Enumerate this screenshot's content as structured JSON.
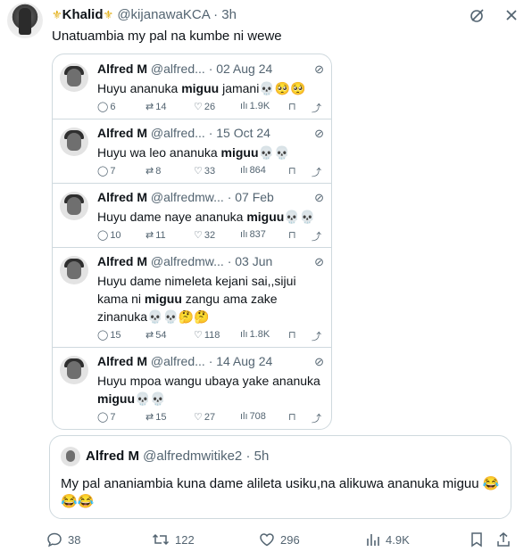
{
  "tweet": {
    "crown_left": "⚜",
    "author_name": "Khalid",
    "crown_right": "⚜",
    "handle": "@kijanawaKCA",
    "time": "· 3h",
    "text": "Unatuambia my pal na kumbe ni wewe",
    "icons": [
      "grok-icon",
      "more-icon"
    ]
  },
  "embedded_tweets": [
    {
      "name": "Alfred M",
      "handle": "@alfred...",
      "date": "· 02 Aug 24",
      "text_before": "Huyu ananuka ",
      "text_bold": "miguu",
      "text_after": " jamani💀🥺🥺",
      "replies": "6",
      "retweets": "14",
      "likes": "26",
      "views": "1.9K"
    },
    {
      "name": "Alfred M",
      "handle": "@alfred...",
      "date": "· 15 Oct 24",
      "text_before": "Huyu wa leo ananuka ",
      "text_bold": "miguu",
      "text_after": "💀💀",
      "replies": "7",
      "retweets": "8",
      "likes": "33",
      "views": "864"
    },
    {
      "name": "Alfred M",
      "handle": "@alfredmw...",
      "date": "· 07 Feb",
      "text_before": "Huyu dame naye ananuka ",
      "text_bold": "miguu",
      "text_after": "💀💀",
      "replies": "10",
      "retweets": "11",
      "likes": "32",
      "views": "837"
    },
    {
      "name": "Alfred M",
      "handle": "@alfredmw...",
      "date": "· 03 Jun",
      "text_before": "Huyu dame nimeleta kejani sai,,sijui kama ni ",
      "text_bold": "miguu",
      "text_after": " zangu ama zake zinanuka💀💀🤔🤔",
      "replies": "15",
      "retweets": "54",
      "likes": "118",
      "views": "1.8K"
    },
    {
      "name": "Alfred M",
      "handle": "@alfred...",
      "date": "· 14 Aug 24",
      "text_before": "Huyu mpoa wangu ubaya yake ananuka ",
      "text_bold": "miguu",
      "text_after": "💀💀",
      "replies": "7",
      "retweets": "15",
      "likes": "27",
      "views": "708"
    }
  ],
  "quoted": {
    "name": "Alfred M",
    "handle": "@alfredmwitike2",
    "time": "· 5h",
    "text": "My pal ananiambia kuna dame alileta usiku,na alikuwa ananuka miguu 😂😂😂"
  },
  "actions": {
    "replies": "38",
    "retweets": "122",
    "likes": "296",
    "views": "4.9K"
  },
  "icons": {
    "reply": "💬",
    "retweet": "⇄",
    "like": "♡",
    "views": "📊",
    "bookmark": "🔖",
    "share": "⇪",
    "grok": "⊘",
    "more": "✕"
  }
}
